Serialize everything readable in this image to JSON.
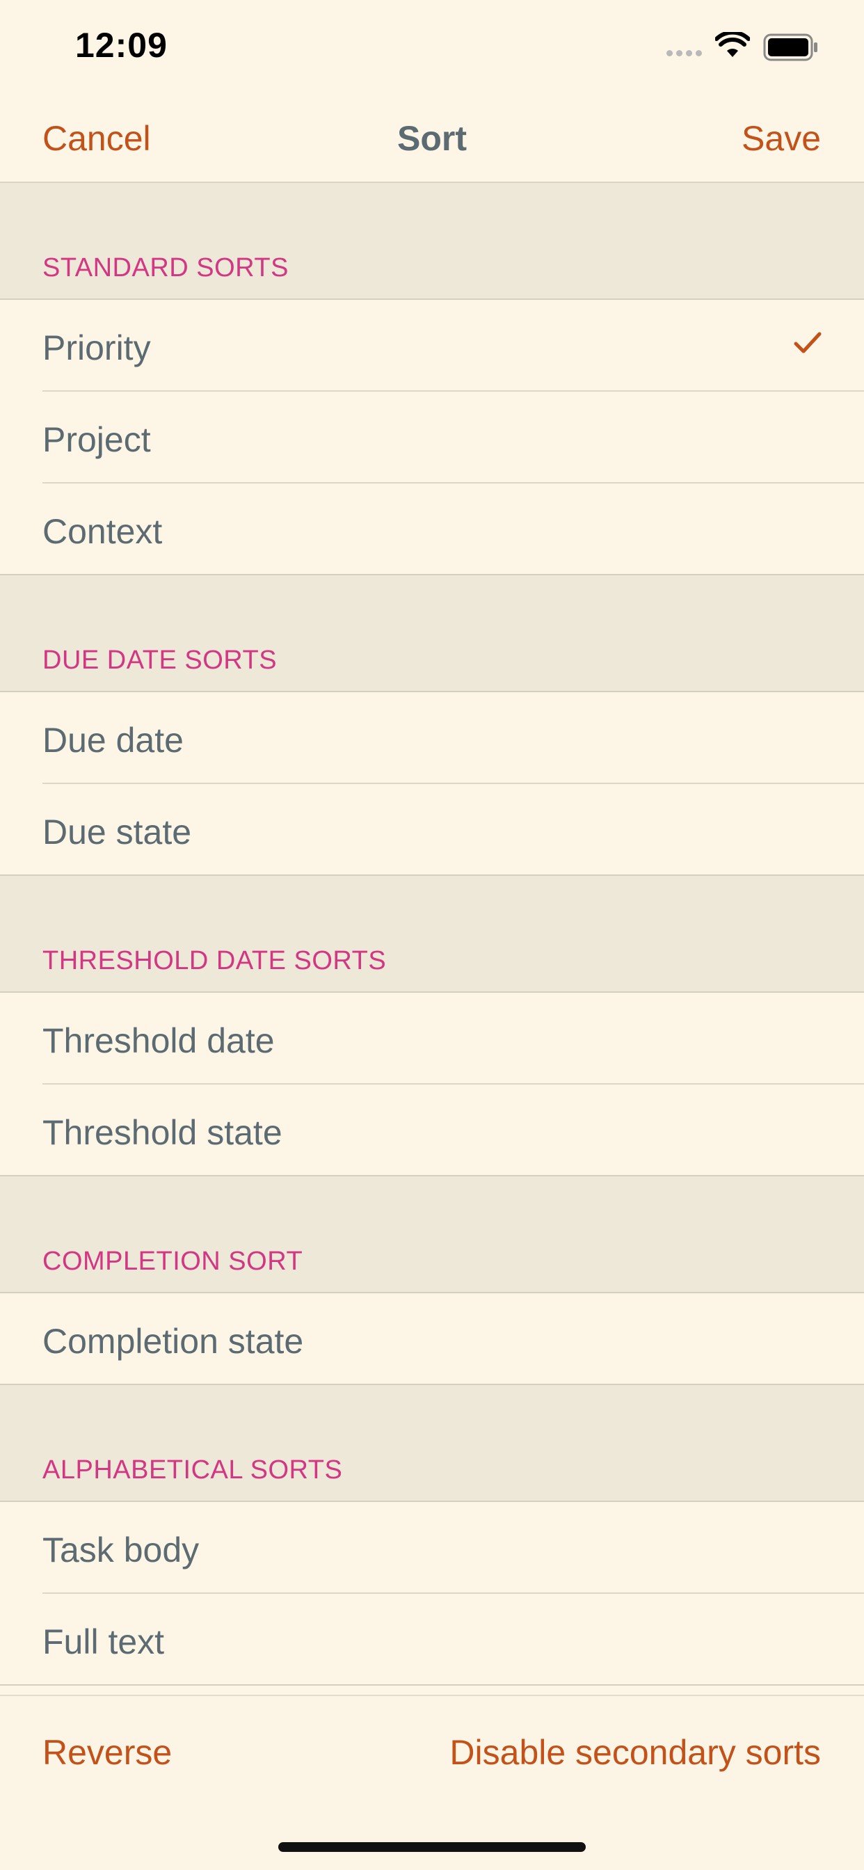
{
  "status_bar": {
    "time": "12:09"
  },
  "nav": {
    "cancel_label": "Cancel",
    "title": "Sort",
    "save_label": "Save"
  },
  "sections": [
    {
      "header": "STANDARD SORTS",
      "rows": [
        {
          "label": "Priority",
          "selected": true
        },
        {
          "label": "Project",
          "selected": false
        },
        {
          "label": "Context",
          "selected": false
        }
      ]
    },
    {
      "header": "DUE DATE SORTS",
      "rows": [
        {
          "label": "Due date",
          "selected": false
        },
        {
          "label": "Due state",
          "selected": false
        }
      ]
    },
    {
      "header": "THRESHOLD DATE SORTS",
      "rows": [
        {
          "label": "Threshold date",
          "selected": false
        },
        {
          "label": "Threshold state",
          "selected": false
        }
      ]
    },
    {
      "header": "COMPLETION SORT",
      "rows": [
        {
          "label": "Completion state",
          "selected": false
        }
      ]
    },
    {
      "header": "ALPHABETICAL SORTS",
      "rows": [
        {
          "label": "Task body",
          "selected": false
        },
        {
          "label": "Full text",
          "selected": false
        }
      ]
    }
  ],
  "toolbar": {
    "reverse_label": "Reverse",
    "disable_label": "Disable secondary sorts"
  },
  "colors": {
    "accent": "#c2511a",
    "section_header_text": "#d33682",
    "row_text": "#5b6b71",
    "background": "#fdf6e7",
    "section_bg": "#eee8d8"
  },
  "icons": {
    "checkmark": "checkmark-icon",
    "wifi": "wifi-icon",
    "battery": "battery-icon"
  }
}
